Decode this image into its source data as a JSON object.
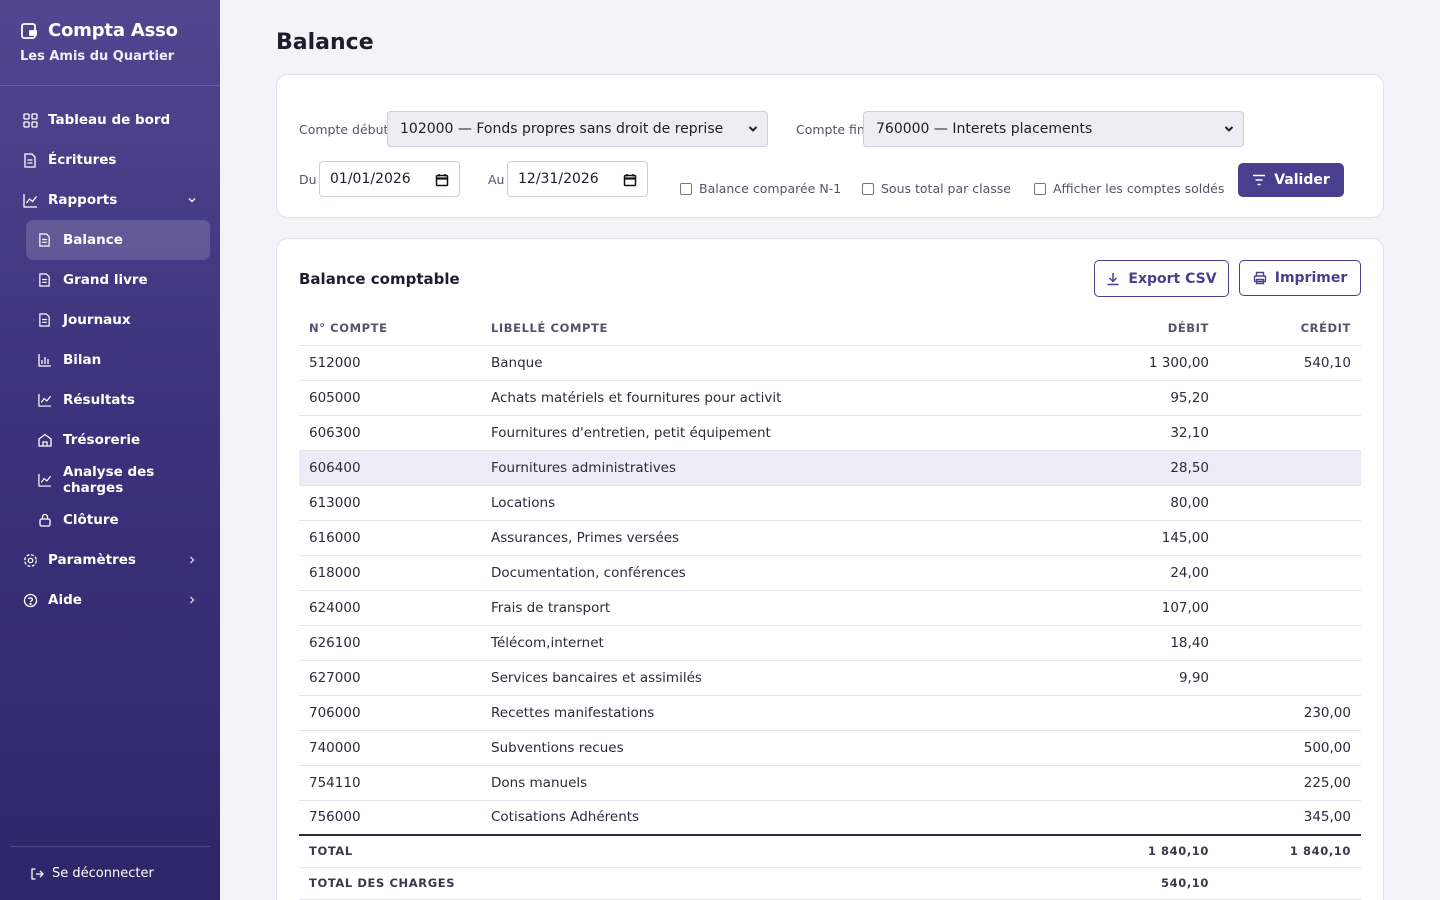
{
  "app": {
    "name": "Compta Asso",
    "organization": "Les Amis du Quartier"
  },
  "sidebar": {
    "items": [
      {
        "label": "Tableau de bord",
        "icon": "grid-icon"
      },
      {
        "label": "Écritures",
        "icon": "document-icon"
      },
      {
        "label": "Rapports",
        "icon": "chart-line-icon",
        "expanded": true
      }
    ],
    "subitems": [
      {
        "label": "Balance",
        "icon": "document-icon",
        "active": true
      },
      {
        "label": "Grand livre",
        "icon": "document-icon"
      },
      {
        "label": "Journaux",
        "icon": "document-icon"
      },
      {
        "label": "Bilan",
        "icon": "bar-chart-icon"
      },
      {
        "label": "Résultats",
        "icon": "chart-line-icon"
      },
      {
        "label": "Trésorerie",
        "icon": "bank-icon"
      },
      {
        "label": "Analyse des charges",
        "icon": "chart-line-icon"
      },
      {
        "label": "Clôture",
        "icon": "lock-icon"
      }
    ],
    "bottom_items": [
      {
        "label": "Paramètres",
        "icon": "gear-icon"
      },
      {
        "label": "Aide",
        "icon": "help-icon"
      }
    ],
    "logout": "Se déconnecter"
  },
  "page": {
    "title": "Balance"
  },
  "filters": {
    "compte_debut_label": "Compte début",
    "compte_debut_value": "102000 — Fonds propres sans droit de reprise",
    "compte_fin_label": "Compte fin",
    "compte_fin_value": "760000 — Interets placements",
    "du_label": "Du",
    "du_value": "01/01/2026",
    "au_label": "Au",
    "au_value": "12/31/2026",
    "checkboxes": [
      {
        "label": "Balance comparée N-1",
        "checked": false
      },
      {
        "label": "Sous total par classe",
        "checked": false
      },
      {
        "label": "Afficher les comptes soldés",
        "checked": false
      }
    ],
    "submit_label": "Valider"
  },
  "table_card": {
    "title": "Balance comptable",
    "export_label": "Export CSV",
    "print_label": "Imprimer",
    "columns": [
      "N° compte",
      "Libellé compte",
      "Débit",
      "Crédit"
    ],
    "rows": [
      {
        "num": "512000",
        "label": "Banque",
        "debit": "1 300,00",
        "credit": "540,10"
      },
      {
        "num": "605000",
        "label": "Achats matériels et fournitures pour activit",
        "debit": "95,20",
        "credit": ""
      },
      {
        "num": "606300",
        "label": "Fournitures d'entretien, petit équipement",
        "debit": "32,10",
        "credit": ""
      },
      {
        "num": "606400",
        "label": "Fournitures administratives",
        "debit": "28,50",
        "credit": "",
        "highlight": true
      },
      {
        "num": "613000",
        "label": "Locations",
        "debit": "80,00",
        "credit": ""
      },
      {
        "num": "616000",
        "label": "Assurances, Primes versées",
        "debit": "145,00",
        "credit": ""
      },
      {
        "num": "618000",
        "label": "Documentation, conférences",
        "debit": "24,00",
        "credit": ""
      },
      {
        "num": "624000",
        "label": "Frais de transport",
        "debit": "107,00",
        "credit": ""
      },
      {
        "num": "626100",
        "label": "Télécom,internet",
        "debit": "18,40",
        "credit": ""
      },
      {
        "num": "627000",
        "label": "Services bancaires et assimilés",
        "debit": "9,90",
        "credit": ""
      },
      {
        "num": "706000",
        "label": "Recettes manifestations",
        "debit": "",
        "credit": "230,00"
      },
      {
        "num": "740000",
        "label": "Subventions recues",
        "debit": "",
        "credit": "500,00"
      },
      {
        "num": "754110",
        "label": "Dons manuels",
        "debit": "",
        "credit": "225,00"
      },
      {
        "num": "756000",
        "label": "Cotisations Adhérents",
        "debit": "",
        "credit": "345,00"
      }
    ],
    "totals": [
      {
        "label": "Total",
        "debit": "1 840,10",
        "credit": "1 840,10"
      },
      {
        "label": "Total des charges",
        "debit": "540,10",
        "credit": ""
      }
    ]
  },
  "colors": {
    "sidebar_top": "#51468f",
    "sidebar_bottom": "#2f2669",
    "accent": "#4a3f8e"
  }
}
